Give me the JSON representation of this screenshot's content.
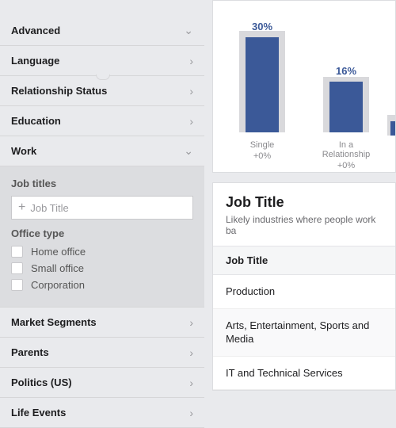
{
  "sidebar": {
    "items": [
      {
        "label": "Advanced",
        "icon": "down"
      },
      {
        "label": "Language",
        "icon": "right"
      },
      {
        "label": "Relationship Status",
        "icon": "right"
      },
      {
        "label": "Education",
        "icon": "right"
      },
      {
        "label": "Work",
        "icon": "down"
      }
    ],
    "work": {
      "job_titles_header": "Job titles",
      "job_title_placeholder": "Job Title",
      "office_type_header": "Office type",
      "options": [
        "Home office",
        "Small office",
        "Corporation"
      ]
    },
    "items2": [
      {
        "label": "Market Segments",
        "icon": "right"
      },
      {
        "label": "Parents",
        "icon": "right"
      },
      {
        "label": "Politics (US)",
        "icon": "right"
      },
      {
        "label": "Life Events",
        "icon": "right"
      }
    ]
  },
  "chart_data": {
    "type": "bar",
    "categories": [
      "Single",
      "In a Relationship"
    ],
    "values": [
      30,
      16
    ],
    "deltas": [
      "+0%",
      "+0%"
    ],
    "ylim": [
      0,
      40
    ],
    "color": "#3b5998"
  },
  "table": {
    "title": "Job Title",
    "subtitle": "Likely industries where people work ba",
    "column": "Job Title",
    "rows": [
      "Production",
      "Arts, Entertainment, Sports and Media",
      "IT and Technical Services"
    ]
  }
}
